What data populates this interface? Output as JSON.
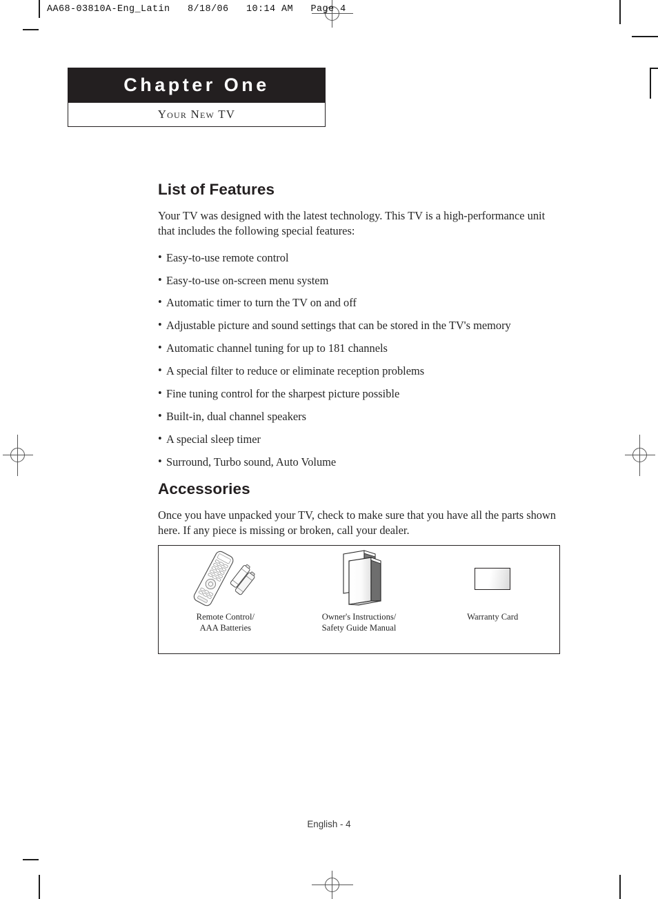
{
  "prepress": {
    "slug": "AA68-03810A-Eng_Latin   8/18/06   10:14 AM   Page 4"
  },
  "chapter": {
    "title": "Chapter One",
    "subtitle": "Your New TV"
  },
  "features": {
    "heading": "List of Features",
    "intro": "Your TV was designed with the latest technology. This TV is a high-performance unit that includes the following special features:",
    "items": [
      "Easy-to-use remote control",
      "Easy-to-use on-screen menu system",
      "Automatic timer to turn the TV on and off",
      "Adjustable picture and sound settings that can be stored in the TV's memory",
      "Automatic channel tuning for up to 181 channels",
      "A special filter to reduce or eliminate reception problems",
      "Fine tuning control for the sharpest picture possible",
      "Built-in, dual channel speakers",
      "A special sleep timer",
      "Surround, Turbo sound, Auto Volume"
    ]
  },
  "accessories": {
    "heading": "Accessories",
    "intro": "Once you have unpacked your TV, check to make sure that you have all the parts shown here. If any piece is missing or broken, call your dealer.",
    "items": [
      {
        "icon": "remote-control-and-batteries-illustration",
        "caption_line1": "Remote Control/",
        "caption_line2": "AAA Batteries"
      },
      {
        "icon": "instruction-manuals-illustration",
        "caption_line1": "Owner's Instructions/",
        "caption_line2": "Safety Guide Manual"
      },
      {
        "icon": "warranty-card-illustration",
        "caption_line1": "Warranty Card",
        "caption_line2": ""
      }
    ]
  },
  "footer": {
    "page_label": "English - 4"
  },
  "colors": {
    "chapter_bar": "#231f20",
    "text": "#262626",
    "page_background": "#ffffff"
  }
}
